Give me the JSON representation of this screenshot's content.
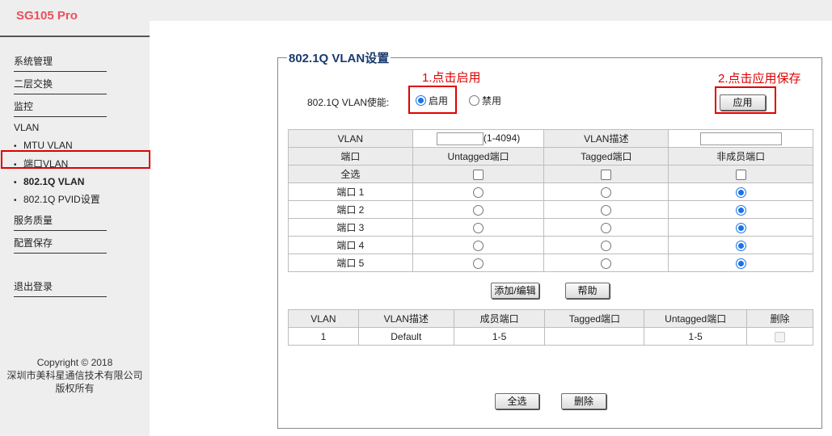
{
  "app": {
    "brand": "SG105 Pro"
  },
  "sidebar": {
    "items": [
      {
        "label": "系统管理"
      },
      {
        "label": "二层交换"
      },
      {
        "label": "监控"
      },
      {
        "label": "VLAN"
      },
      {
        "label": "MTU VLAN"
      },
      {
        "label": "端口VLAN"
      },
      {
        "label": "802.1Q VLAN"
      },
      {
        "label": "802.1Q PVID设置"
      },
      {
        "label": "服务质量"
      },
      {
        "label": "配置保存"
      },
      {
        "label": "退出登录"
      }
    ],
    "active": "802.1Q VLAN",
    "copyright": [
      "Copyright © 2018",
      "深圳市美科星通信技术有限公司",
      "版权所有"
    ]
  },
  "section": {
    "title": "802.1Q VLAN设置"
  },
  "annotations": {
    "step1": "1.点击启用",
    "step2": "2.点击应用保存"
  },
  "enable": {
    "label": "802.1Q VLAN使能:",
    "options": [
      {
        "label": "启用",
        "selected": true
      },
      {
        "label": "禁用",
        "selected": false
      }
    ],
    "apply_label": "应用"
  },
  "config_table": {
    "vlan_label": "VLAN",
    "vlan_input_value": "",
    "vlan_range": "(1-4094)",
    "desc_label": "VLAN描述",
    "desc_input_value": "",
    "headers": [
      "端口",
      "Untagged端口",
      "Tagged端口",
      "非成员端口"
    ],
    "select_all_label": "全选",
    "ports": [
      {
        "label": "端口 1",
        "mode": "non-member"
      },
      {
        "label": "端口 2",
        "mode": "non-member"
      },
      {
        "label": "端口 3",
        "mode": "non-member"
      },
      {
        "label": "端口 4",
        "mode": "non-member"
      },
      {
        "label": "端口 5",
        "mode": "non-member"
      }
    ]
  },
  "actions": {
    "add_edit": "添加/编辑",
    "help": "帮助"
  },
  "vlan_table": {
    "headers": [
      "VLAN",
      "VLAN描述",
      "成员端口",
      "Tagged端口",
      "Untagged端口",
      "删除"
    ],
    "rows": [
      {
        "vlan": "1",
        "desc": "Default",
        "members": "1-5",
        "tagged": "",
        "untagged": "1-5"
      }
    ]
  },
  "footer_actions": {
    "select_all": "全选",
    "delete": "删除"
  },
  "colors": {
    "brand": "#e8515b",
    "annotation": "#e00000",
    "radio_selected": "#1a73e8"
  }
}
